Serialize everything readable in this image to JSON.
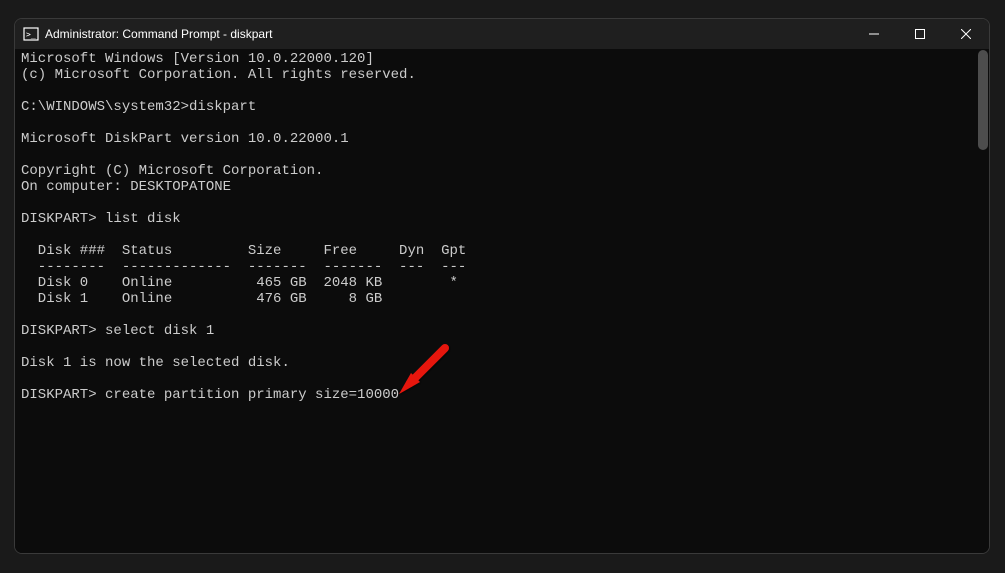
{
  "window": {
    "title": "Administrator: Command Prompt - diskpart"
  },
  "terminal": {
    "line1": "Microsoft Windows [Version 10.0.22000.120]",
    "line2": "(c) Microsoft Corporation. All rights reserved.",
    "blank1": "",
    "line3": "C:\\WINDOWS\\system32>diskpart",
    "blank2": "",
    "line4": "Microsoft DiskPart version 10.0.22000.1",
    "blank3": "",
    "line5": "Copyright (C) Microsoft Corporation.",
    "line6": "On computer: DESKTOPATONE",
    "blank4": "",
    "line7": "DISKPART> list disk",
    "blank5": "",
    "tableHeader": "  Disk ###  Status         Size     Free     Dyn  Gpt",
    "tableDivider": "  --------  -------------  -------  -------  ---  ---",
    "tableRow1": "  Disk 0    Online          465 GB  2048 KB        *",
    "tableRow2": "  Disk 1    Online          476 GB     8 GB",
    "blank6": "",
    "line8": "DISKPART> select disk 1",
    "blank7": "",
    "line9": "Disk 1 is now the selected disk.",
    "blank8": "",
    "line10": "DISKPART> create partition primary size=10000"
  }
}
